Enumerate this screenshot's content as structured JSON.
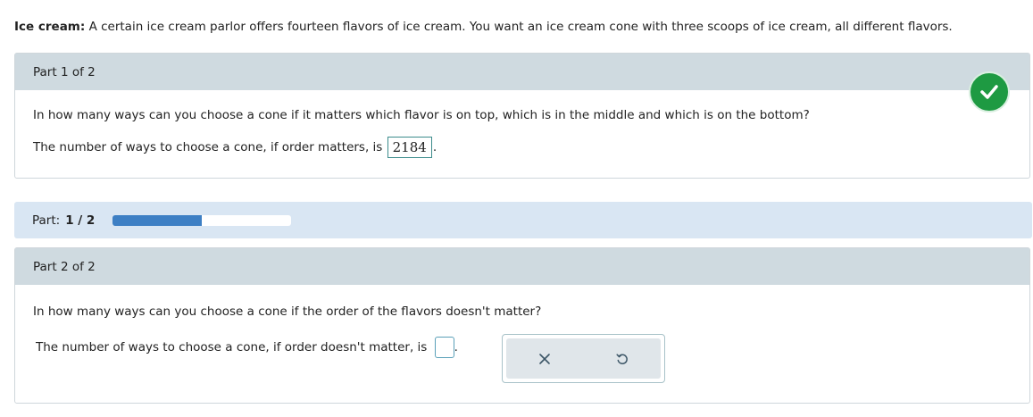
{
  "problem": {
    "label": "Ice cream:",
    "text": " A certain ice cream parlor offers fourteen flavors of ice cream. You want an ice cream cone with three scoops of ice cream, all different flavors."
  },
  "part1": {
    "header": "Part 1 of 2",
    "question": "In how many ways can you choose a cone if it matters which flavor is on top, which is in the middle and which is on the bottom?",
    "answer_prefix": "The number of ways to choose a cone, if order matters, is",
    "answer_value": "2184",
    "answer_suffix": ".",
    "status_icon": "checkmark-icon",
    "status_color": "#1e9a42"
  },
  "progress": {
    "label": "Part:",
    "value_text": "1 / 2",
    "fraction": 0.5,
    "fill_color": "#3d7fc4"
  },
  "part2": {
    "header": "Part 2 of 2",
    "question": "In how many ways can you choose a cone if the order of the flavors doesn't matter?",
    "answer_prefix": "The number of ways to choose a cone, if order doesn't matter, is",
    "answer_value": "",
    "answer_suffix": ".",
    "tools": [
      "clear-icon",
      "undo-icon"
    ]
  }
}
